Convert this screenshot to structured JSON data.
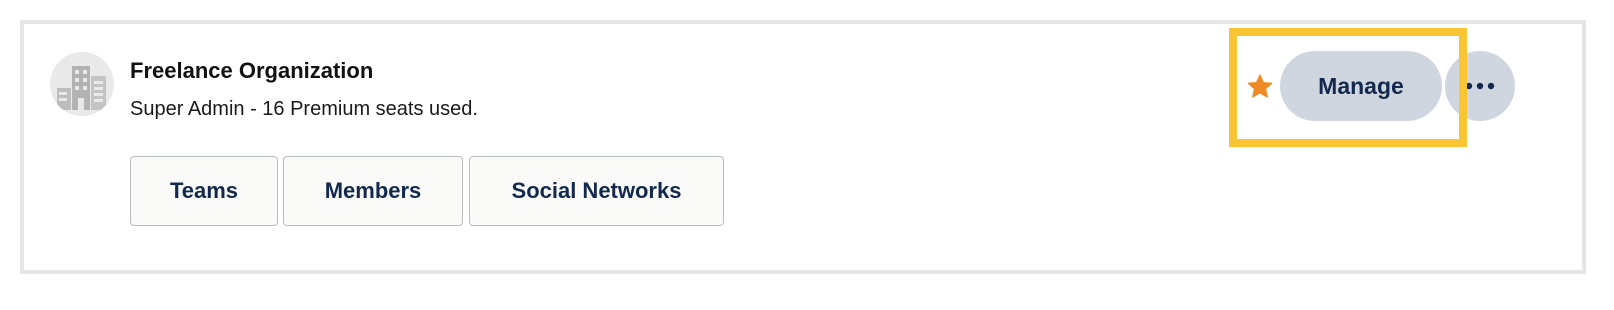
{
  "organization": {
    "name": "Freelance Organization",
    "subtitle": "Super Admin - 16 Premium seats used.",
    "avatar_icon": "building-icon"
  },
  "tabs": [
    {
      "label": "Teams"
    },
    {
      "label": "Members"
    },
    {
      "label": "Social Networks"
    }
  ],
  "actions": {
    "favorite_icon": "star-icon",
    "favorite_color": "#f08a24",
    "manage_label": "Manage",
    "more_icon": "ellipsis-icon"
  },
  "colors": {
    "highlight": "#f9c534",
    "button_bg": "#d0d6df",
    "button_text": "#12294d"
  }
}
